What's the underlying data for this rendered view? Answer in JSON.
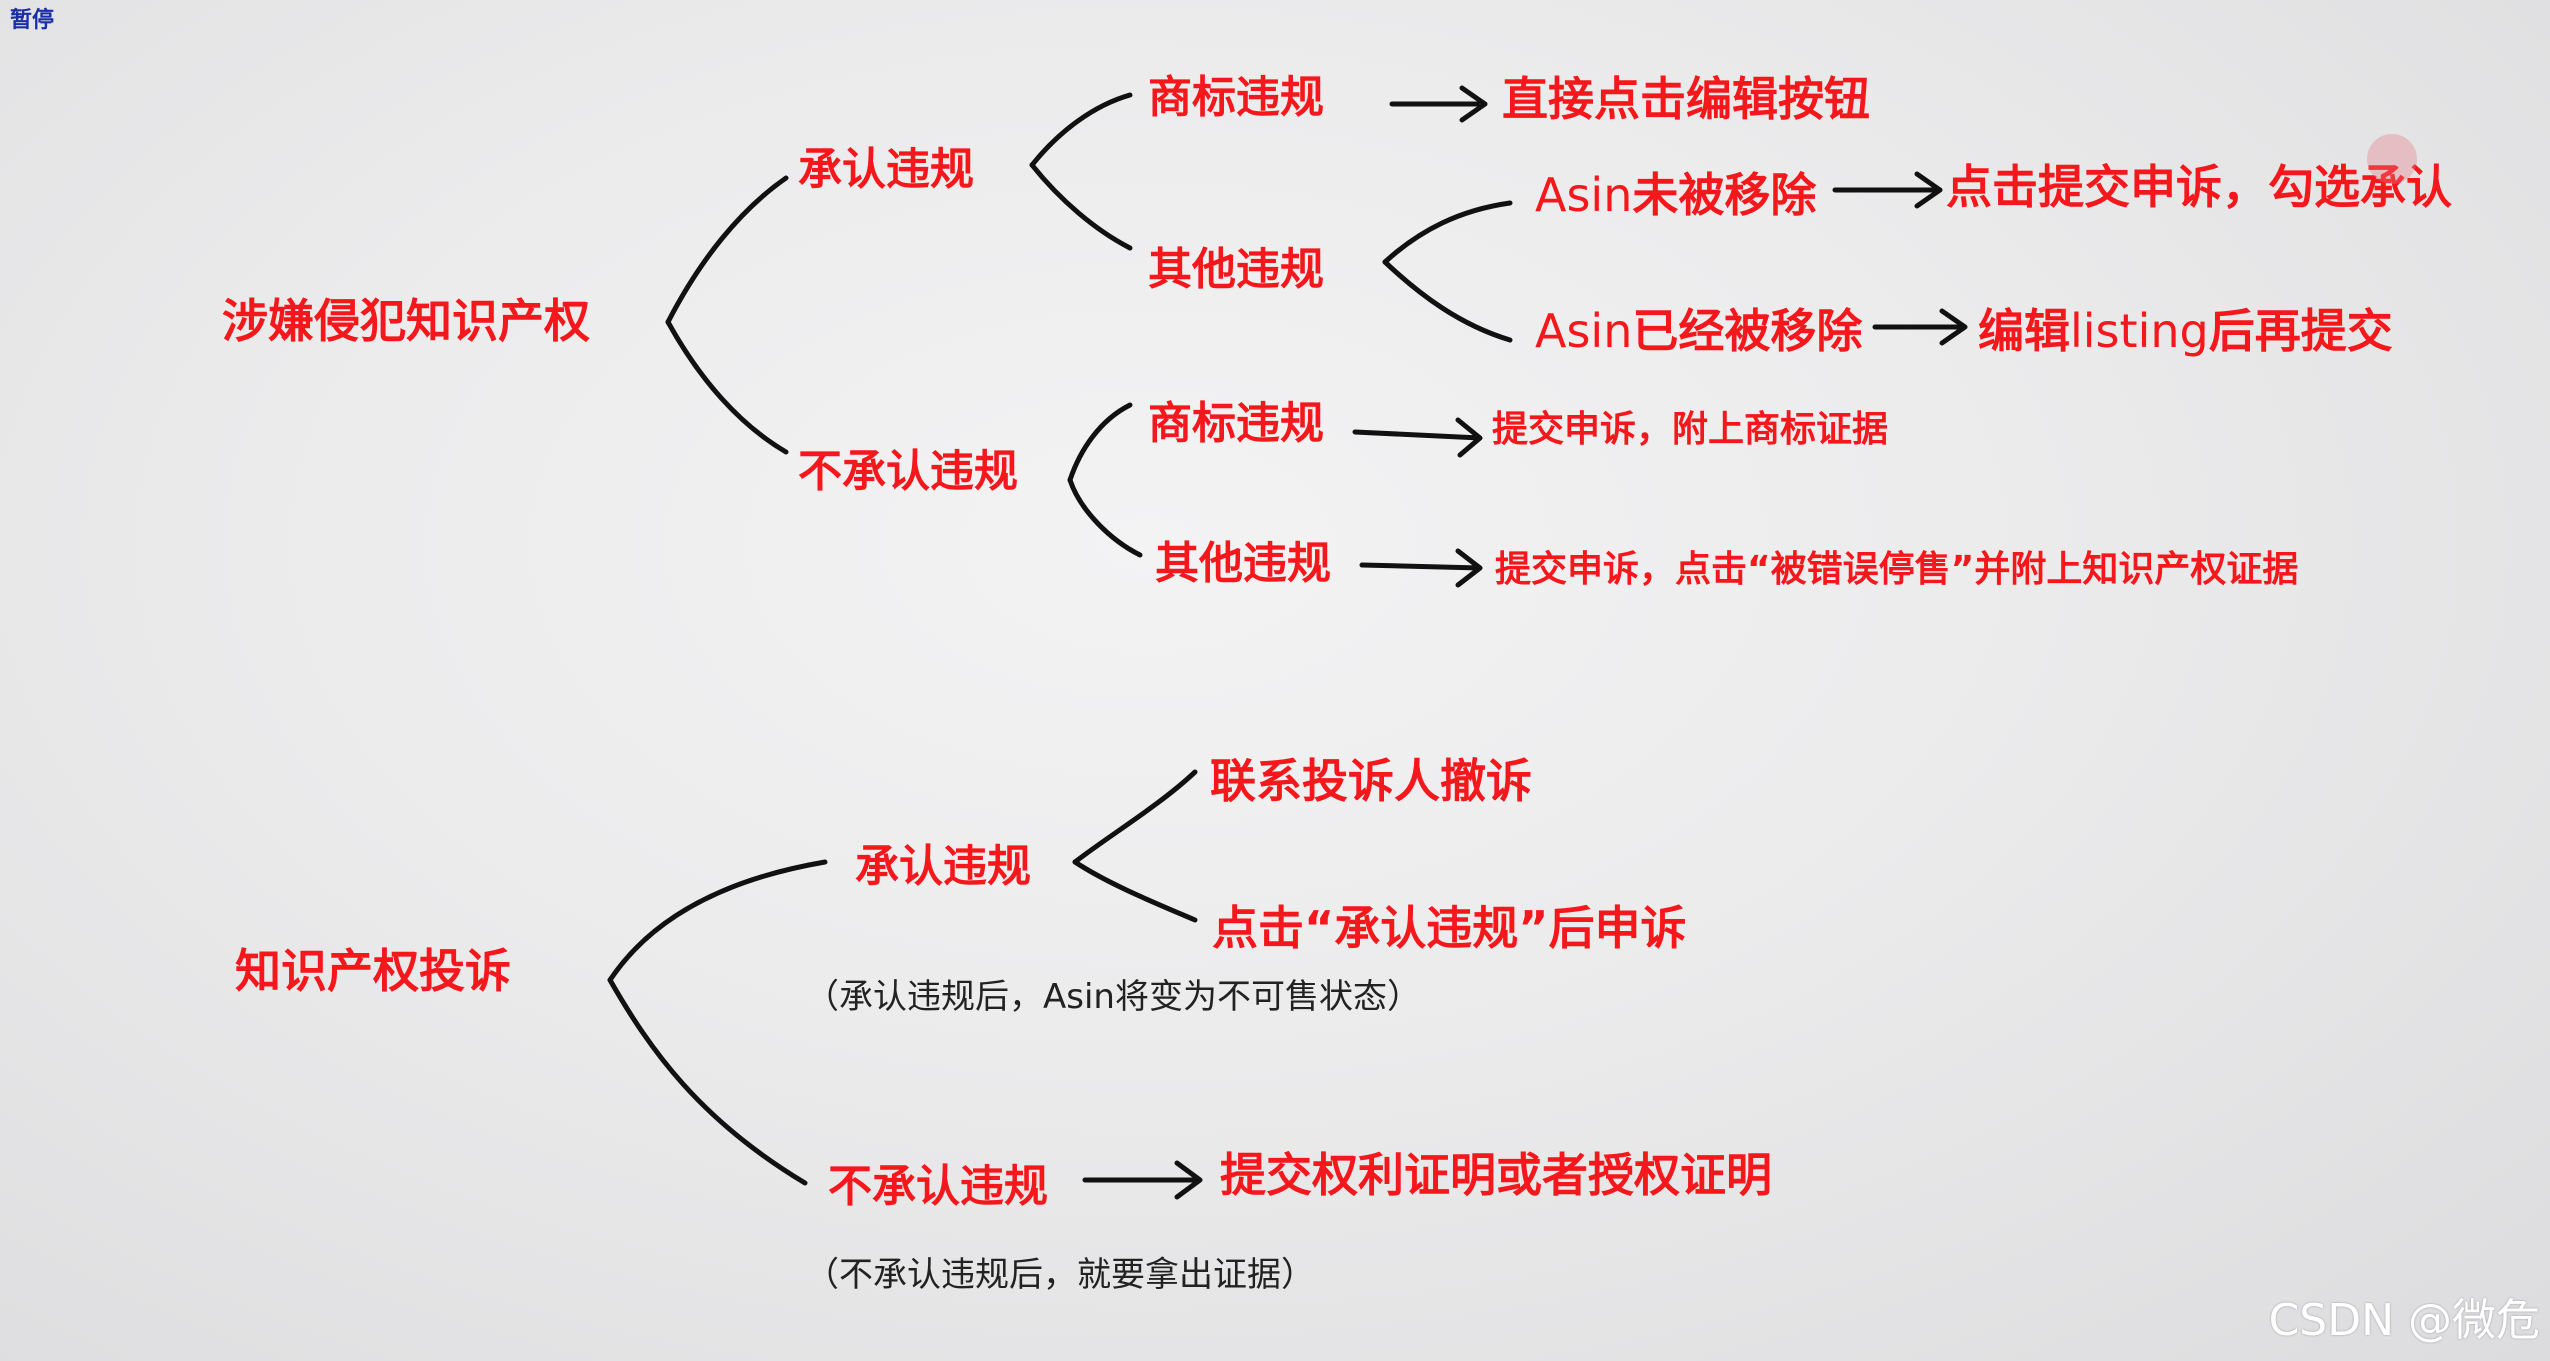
{
  "overlay": {
    "pause_label": "暂停",
    "watermark": "CSDN @微危"
  },
  "section1": {
    "root": "涉嫌侵犯知识产权",
    "admit": {
      "label": "承认违规",
      "trademark": {
        "label": "商标违规",
        "action": "直接点击编辑按钮"
      },
      "other": {
        "label": "其他违规",
        "asin_not_removed": {
          "label_latin": "Asin",
          "label_cjk": "未被移除",
          "action": "点击提交申诉，勾选承认"
        },
        "asin_removed": {
          "label_latin": "Asin",
          "label_cjk": "已经被移除",
          "action_pre": "编辑",
          "action_latin": "listing",
          "action_post": "后再提交"
        }
      }
    },
    "deny": {
      "label": "不承认违规",
      "trademark": {
        "label": "商标违规",
        "action": "提交申诉，附上商标证据"
      },
      "other": {
        "label": "其他违规",
        "action": "提交申诉，点击“被错误停售”并附上知识产权证据"
      }
    }
  },
  "section2": {
    "root": "知识产权投诉",
    "admit": {
      "label": "承认违规",
      "option1": "联系投诉人撤诉",
      "option2": "点击“承认违规”后申诉",
      "note_pre": "（承认违规后，",
      "note_latin": "Asin",
      "note_post": "将变为不可售状态）"
    },
    "deny": {
      "label": "不承认违规",
      "action": "提交权利证明或者授权证明",
      "note": "（不承认违规后，就要拿出证据）"
    }
  }
}
